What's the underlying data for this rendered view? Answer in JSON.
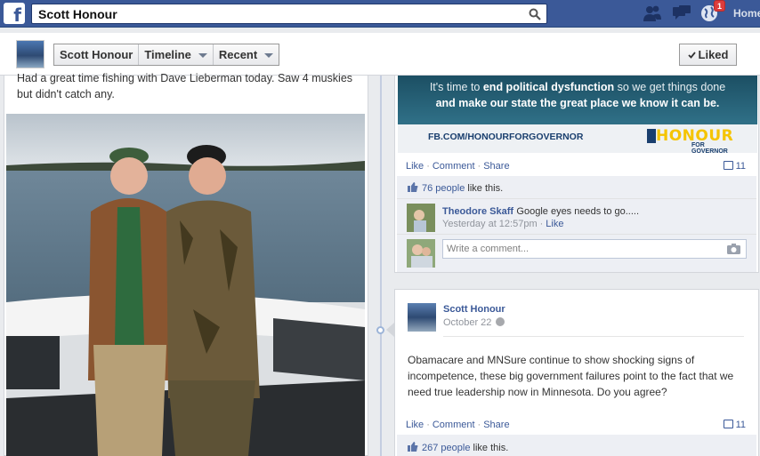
{
  "topbar": {
    "logo": "f",
    "search_value": "Scott Honour",
    "notification_count": "1",
    "home_label": "Home"
  },
  "profile_nav": {
    "name_button": "Scott Honour",
    "timeline_button": "Timeline",
    "recent_button": "Recent",
    "liked_button": "Liked"
  },
  "left_post": {
    "text": "Had a great time fishing with Dave Lieberman today. Saw 4 muskies but didn't catch any."
  },
  "ad_post": {
    "banner_line1_pre": "It's time to ",
    "banner_line1_bold": "end political dysfunction",
    "banner_line1_post": " so we get things done",
    "banner_line2_bold1": "and make our state the great place we know it can be.",
    "url": "FB.COM/HONOURFORGOVERNOR",
    "logo_text": "HONOUR",
    "logo_sub": "FOR GOVERNOR",
    "actions": [
      "Like",
      "Comment",
      "Share"
    ],
    "comment_count": "11",
    "likes_count_text": "76 people",
    "likes_suffix": " like this.",
    "comment": {
      "name": "Theodore Skaff",
      "text": "Google eyes needs to go.....",
      "time": "Yesterday at 12:57pm",
      "like_link": "Like"
    },
    "write_placeholder": "Write a comment..."
  },
  "post2": {
    "author": "Scott Honour",
    "date": "October 22",
    "body": "Obamacare and MNSure continue to show shocking signs of incompetence, these big government failures point to the fact that we need true leadership now in Minnesota. Do you agree?",
    "actions": [
      "Like",
      "Comment",
      "Share"
    ],
    "comment_count": "11",
    "likes_count_text": "267 people",
    "likes_suffix": " like this."
  },
  "colors": {
    "brand_blue": "#3b5998",
    "link_blue": "#3b5998",
    "badge_red": "#dd3c3c",
    "logo_yellow": "#f5c400"
  }
}
